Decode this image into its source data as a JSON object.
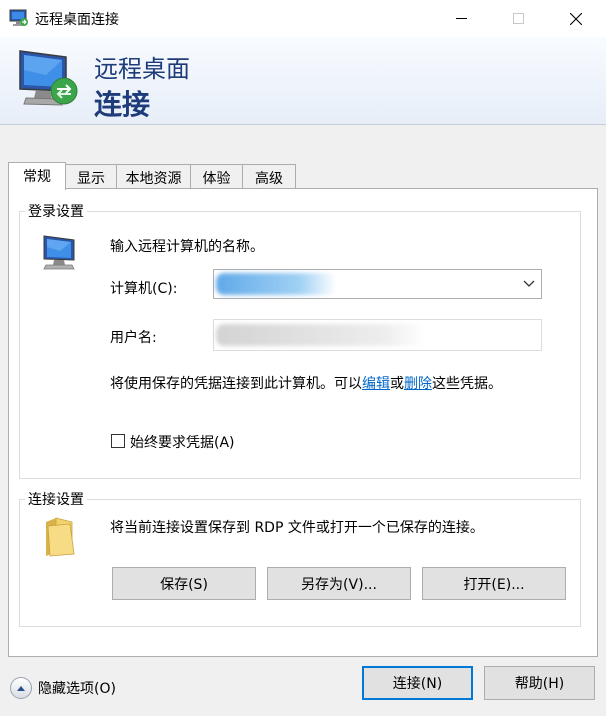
{
  "window": {
    "title": "远程桌面连接",
    "icons": {
      "app": "remote-desktop-icon",
      "minimize": "minimize-icon",
      "maximize": "maximize-icon",
      "close": "close-icon"
    }
  },
  "banner": {
    "line1": "远程桌面",
    "line2": "连接"
  },
  "tabs": [
    {
      "label": "常规",
      "active": true
    },
    {
      "label": "显示"
    },
    {
      "label": "本地资源"
    },
    {
      "label": "体验"
    },
    {
      "label": "高级"
    }
  ],
  "login_settings": {
    "legend": "登录设置",
    "instruction": "输入远程计算机的名称。",
    "computer_label": "计算机(C):",
    "computer_value": "",
    "username_label": "用户名:",
    "username_value": "",
    "saved_creds_prefix": "将使用保存的凭据连接到此计算机。可以",
    "edit_link": "编辑",
    "or_text": "或",
    "delete_link": "删除",
    "saved_creds_suffix": "这些凭据。",
    "always_ask_label": "始终要求凭据(A)",
    "always_ask_checked": false
  },
  "connection_settings": {
    "legend": "连接设置",
    "description": "将当前连接设置保存到 RDP 文件或打开一个已保存的连接。",
    "save_button": "保存(S)",
    "save_as_button": "另存为(V)...",
    "open_button": "打开(E)..."
  },
  "footer": {
    "hide_options": "隐藏选项(O)",
    "connect_button": "连接(N)",
    "help_button": "帮助(H)"
  },
  "colors": {
    "accent": "#0078d7",
    "banner_text": "#1f3c7a",
    "link": "#0066cc"
  }
}
